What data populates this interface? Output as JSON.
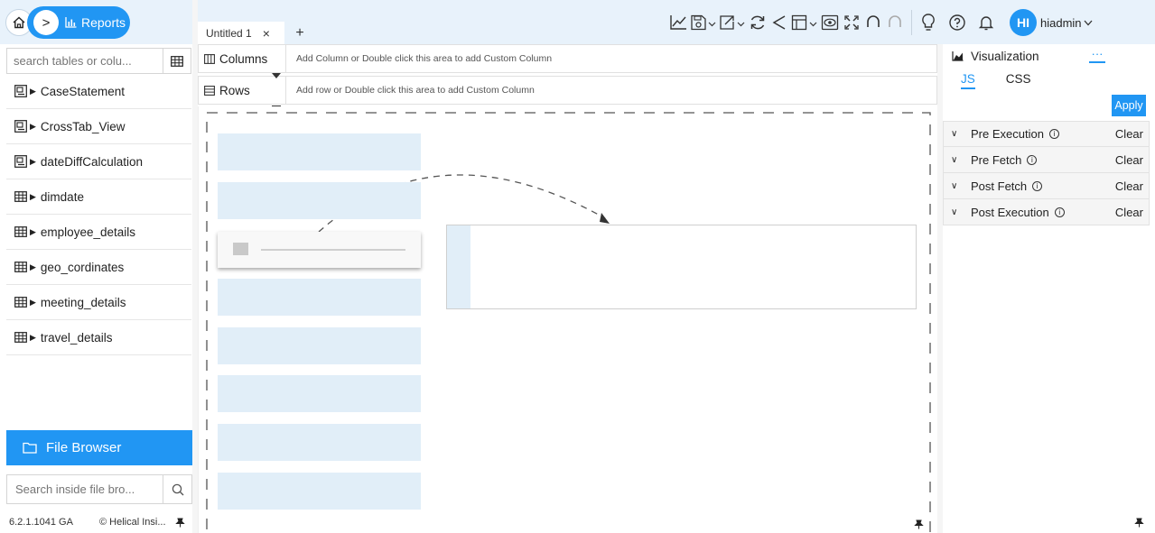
{
  "nav": {
    "home_icon": "home-icon",
    "breadcrumb_chevron": ">",
    "reports_label": "Reports"
  },
  "left": {
    "search_placeholder": "search tables or colu...",
    "tables": [
      {
        "name": "CaseStatement",
        "icon": "view-icon"
      },
      {
        "name": "CrossTab_View",
        "icon": "view-icon"
      },
      {
        "name": "dateDiffCalculation",
        "icon": "view-icon"
      },
      {
        "name": "dimdate",
        "icon": "table-icon"
      },
      {
        "name": "employee_details",
        "icon": "table-icon"
      },
      {
        "name": "geo_cordinates",
        "icon": "table-icon"
      },
      {
        "name": "meeting_details",
        "icon": "table-icon"
      },
      {
        "name": "travel_details",
        "icon": "table-icon"
      }
    ],
    "file_browser_label": "File Browser",
    "file_search_placeholder": "Search inside file bro...",
    "version": "6.2.1.1041 GA",
    "copyright": "© Helical Insi..."
  },
  "tabs": {
    "active_tab": "Untitled 1",
    "close": "×",
    "add": "+"
  },
  "user": {
    "initials": "HI",
    "name": "hiadmin"
  },
  "shelves": {
    "columns_label": "Columns",
    "columns_hint": "Add Column or Double click this area to add Custom Column",
    "rows_label": "Rows",
    "rows_hint": "Add row or Double click this area to add Custom Column"
  },
  "right": {
    "viz_label": "Visualization",
    "more": "···",
    "tab_js": "JS",
    "tab_css": "CSS",
    "apply": "Apply",
    "hooks": [
      {
        "label": "Pre Execution",
        "clear": "Clear"
      },
      {
        "label": "Pre Fetch",
        "clear": "Clear"
      },
      {
        "label": "Post Fetch",
        "clear": "Clear"
      },
      {
        "label": "Post Execution",
        "clear": "Clear"
      }
    ]
  },
  "colors": {
    "accent": "#2196f3",
    "bar_bg": "#e8f2fb",
    "placeholder": "#e1eef8"
  }
}
